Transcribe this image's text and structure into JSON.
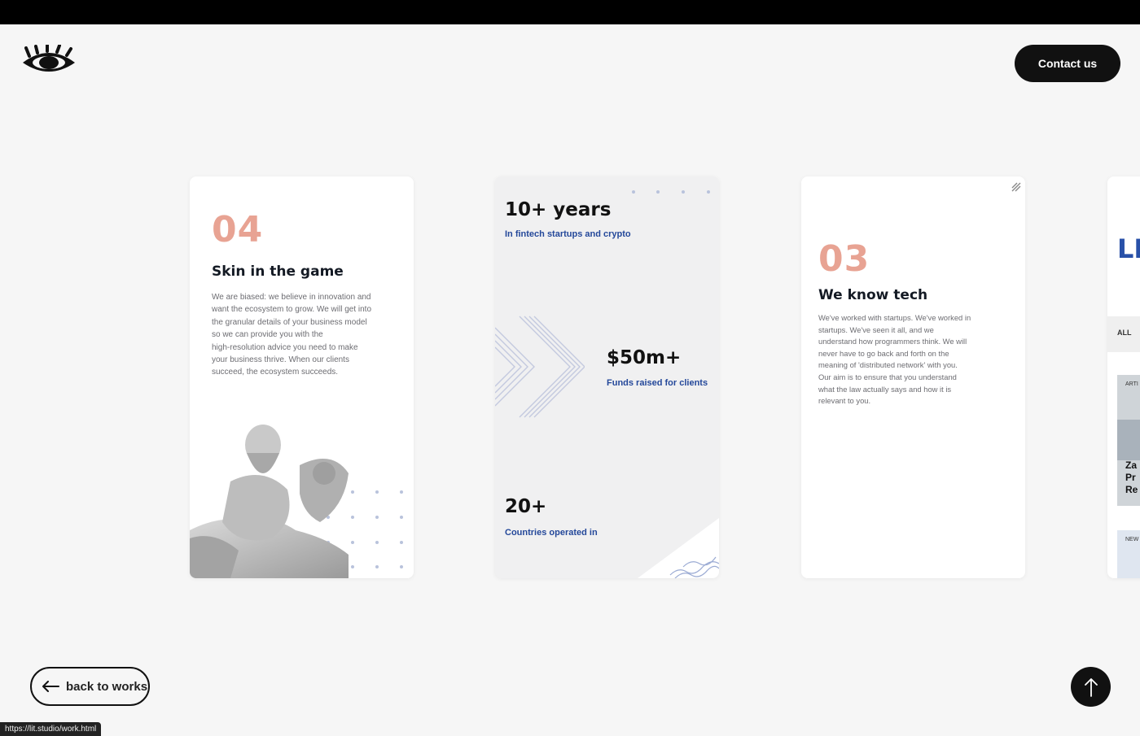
{
  "header": {
    "logo_icon": "eye-logo-icon",
    "contact_label": "Contact us"
  },
  "cards": [
    {
      "number": "04",
      "title": "Skin in the game",
      "lines": [
        "We are biased: we believe in innovation and",
        "want the ecosystem to grow. We will get into",
        "the granular details of your business model",
        "so we can provide you with the",
        "high-resolution advice you need to make",
        "your business thrive. When our clients",
        "succeed, the ecosystem succeeds."
      ],
      "image": "statue-image"
    },
    {
      "stats": [
        {
          "value": "10+ years",
          "label": "In fintech startups and crypto"
        },
        {
          "value": "$50m+",
          "label": "Funds raised for clients"
        },
        {
          "value": "20+",
          "label": "Countries operated in"
        }
      ]
    },
    {
      "number": "03",
      "title": "We know tech",
      "lines": [
        "We've worked with startups. We've worked in",
        "startups. We've seen it all, and we",
        "understand how programmers think. We will",
        "never have to go back and forth on the",
        "meaning of 'distributed network' with you.",
        "Our aim is to ensure that you understand",
        "what the law actually says and how it is",
        "relevant to you."
      ]
    },
    {
      "heading": "LI",
      "filter": "ALL",
      "tag1": "ARTI",
      "snippet": [
        "Za",
        "Pr",
        "Re"
      ],
      "tag2": "NEW"
    }
  ],
  "footer": {
    "back_label": "back to works",
    "status_url": "https://lit.studio/work.html"
  },
  "colors": {
    "accent_number": "#e8a393",
    "accent_blue": "#24489a",
    "background": "#f6f6f6"
  }
}
